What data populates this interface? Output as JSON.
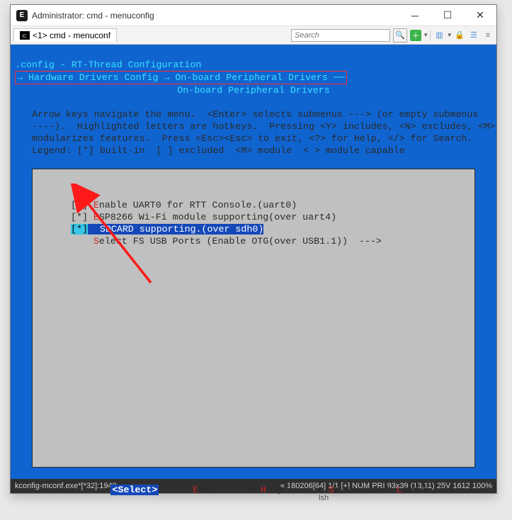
{
  "window": {
    "title": "Administrator: cmd - menuconfig",
    "tab_label": "<1> cmd - menuconf",
    "search_placeholder": "Search"
  },
  "term": {
    "config_line": ".config - RT-Thread Configuration",
    "breadcrumb": "→ Hardware Drivers Config → On-board Peripheral Drivers ──",
    "section_title": "On-board Peripheral Drivers",
    "help1": "Arrow keys navigate the menu.  <Enter> selects submenus ---> (or empty submenus",
    "help2": "----).  Highlighted letters are hotkeys.  Pressing <Y> includes, <N> excludes, <M>",
    "help3": "modularizes features.  Press <Esc><Esc> to exit, <?> for Help, </> for Search.",
    "help4": "Legend: [*] built-in  [ ] excluded  <M> module  < > module capable"
  },
  "menu": {
    "items": [
      {
        "check": "[*]",
        "hk": "E",
        "rest": "nable UART0 for RTT Console.(uart0)"
      },
      {
        "check": "[*]",
        "hk": "E",
        "rest": "SP8266 Wi-Fi module supporting(over uart4)"
      },
      {
        "check": "[*]",
        "hk": " ",
        "rest": "SDCARD supporting.(over sdh0)",
        "selected": true
      },
      {
        "check": "   ",
        "hk": "S",
        "rest": "elect FS USB Ports (Enable OTG(over USB1.1))  --->"
      }
    ]
  },
  "buttons": {
    "select": "<Select>",
    "exit": "< Exit >",
    "help": "< Help >",
    "save": "< Save >",
    "load": "< Load >"
  },
  "status": {
    "left": "kconfig-mconf.exe*[*32]:1948",
    "right": "«  180206[64]   1/1   [+]  NUM   PRI   93x39  (13,11) 25V   1612  100%"
  },
  "lsh": "lsh"
}
